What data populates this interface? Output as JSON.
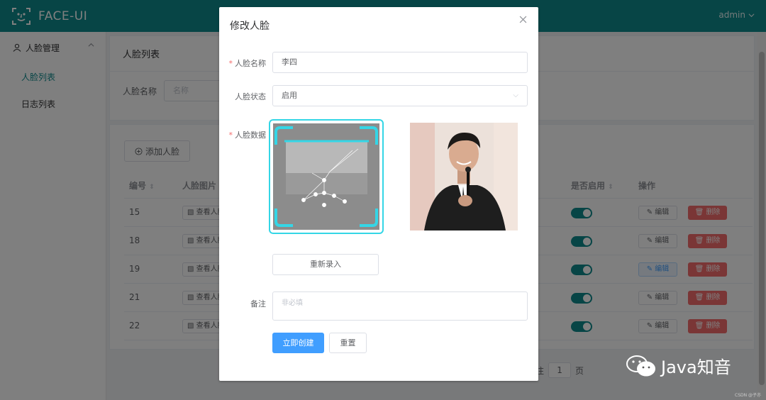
{
  "header": {
    "app_name": "FACE-UI",
    "user": "admin"
  },
  "sidebar": {
    "group_label": "人脸管理",
    "items": [
      {
        "label": "人脸列表"
      },
      {
        "label": "日志列表"
      }
    ]
  },
  "page": {
    "title": "人脸列表",
    "filter_label": "人脸名称",
    "filter_placeholder": "名称",
    "add_button": "添加人脸"
  },
  "table": {
    "columns": [
      "编号",
      "人脸图片",
      "是否启用",
      "操作"
    ],
    "view_label": "查看人脸",
    "edit_label": "编辑",
    "delete_label": "删除",
    "rows": [
      {
        "id": "15",
        "enabled": true
      },
      {
        "id": "18",
        "enabled": true
      },
      {
        "id": "19",
        "enabled": true
      },
      {
        "id": "21",
        "enabled": true
      },
      {
        "id": "22",
        "enabled": true
      }
    ]
  },
  "pagination": {
    "prefix": "往",
    "page": "1",
    "suffix": "页"
  },
  "dialog": {
    "title": "修改人脸",
    "name_label": "人脸名称",
    "name_value": "李四",
    "status_label": "人脸状态",
    "status_value": "启用",
    "data_label": "人脸数据",
    "rerecord_button": "重新录入",
    "remark_label": "备注",
    "remark_placeholder": "非必填",
    "submit_button": "立即创建",
    "reset_button": "重置"
  },
  "watermark": {
    "text": "Java知音",
    "small": "CSDN @子亦"
  },
  "colors": {
    "header": "#0f8a8d",
    "primary": "#409eff",
    "danger": "#f56c6c",
    "capture_frame": "#34d6e6"
  }
}
